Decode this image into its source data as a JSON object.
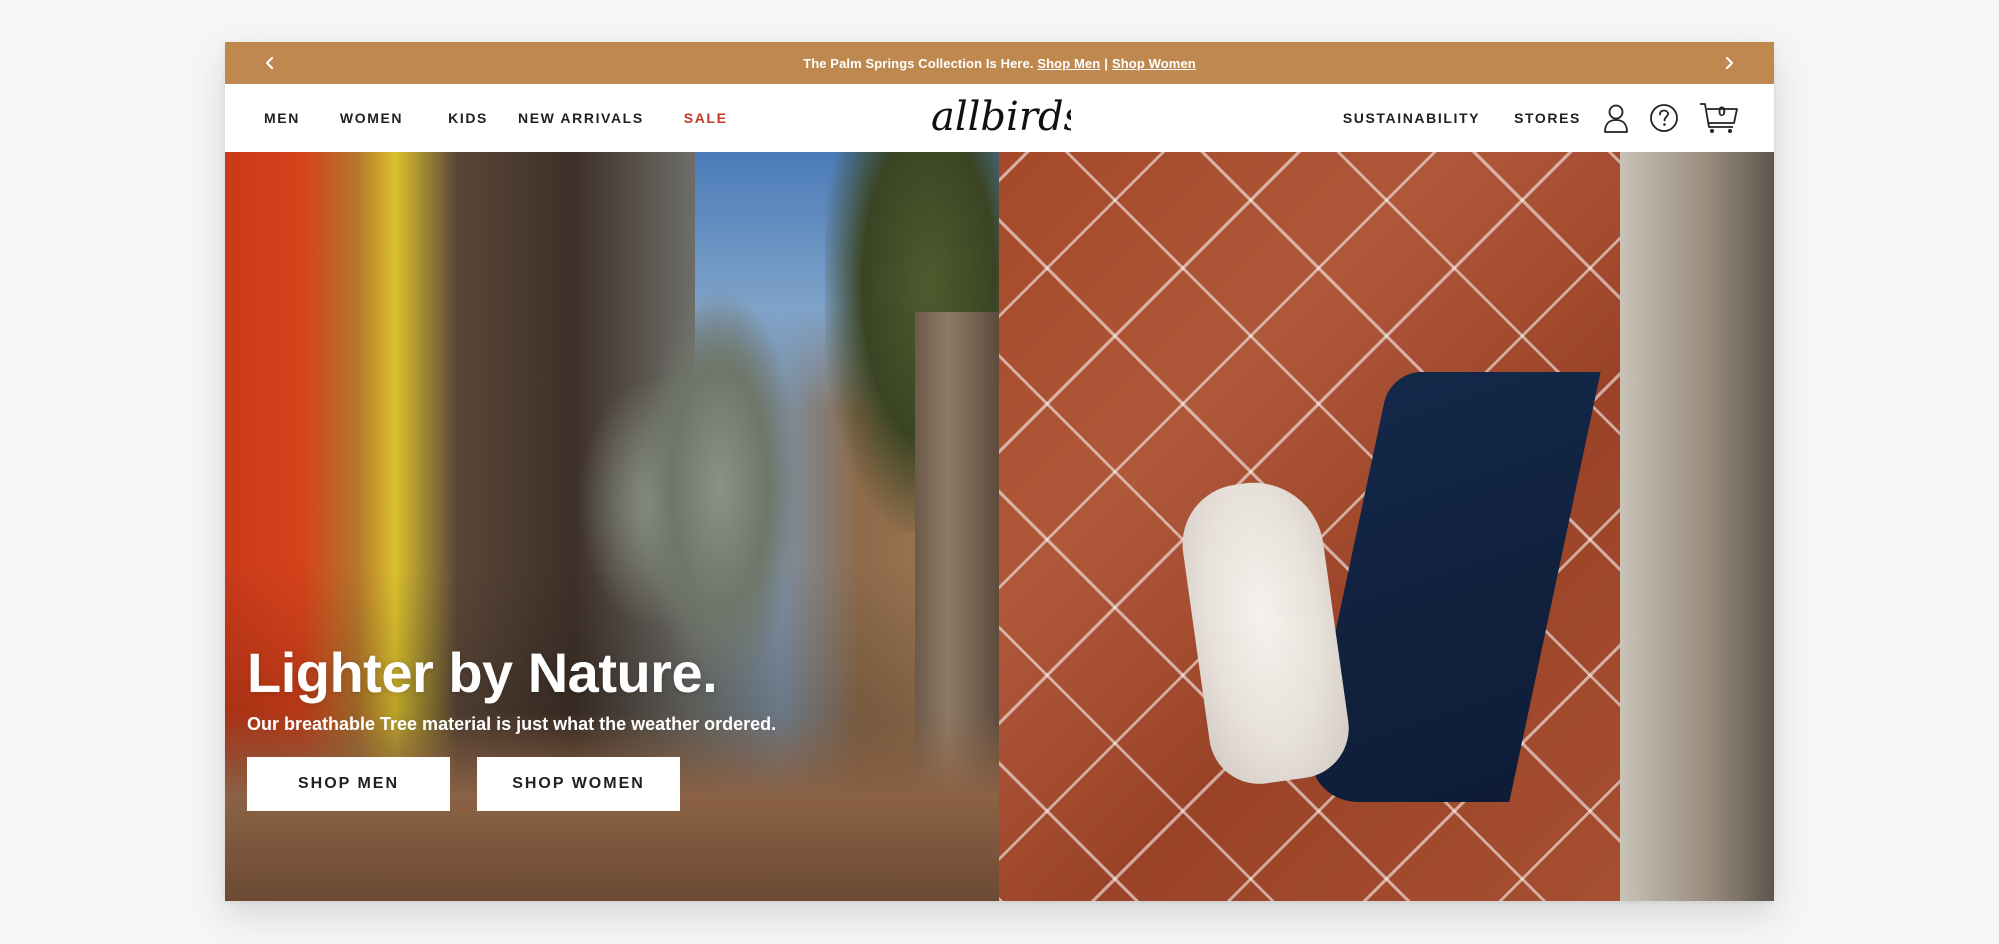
{
  "announcement": {
    "text": "The Palm Springs Collection Is Here.",
    "link_men": "Shop Men",
    "separator": "|",
    "link_women": "Shop Women",
    "bg_color": "#bf884f"
  },
  "nav": {
    "left_items": [
      "MEN",
      "WOMEN",
      "KIDS",
      "NEW ARRIVALS",
      "SALE"
    ],
    "logo": "allbirds",
    "right_items": [
      "SUSTAINABILITY",
      "STORES"
    ],
    "cart_count": "0",
    "sale_color": "#c0392b"
  },
  "hero": {
    "headline": "Lighter by Nature.",
    "subheadline": "Our breathable Tree material is just what the weather ordered.",
    "cta_men": "SHOP MEN",
    "cta_women": "SHOP WOMEN"
  },
  "icons": {
    "prev": "chevron-left-icon",
    "next": "chevron-right-icon",
    "account": "user-icon",
    "help": "help-icon",
    "cart": "cart-icon"
  }
}
